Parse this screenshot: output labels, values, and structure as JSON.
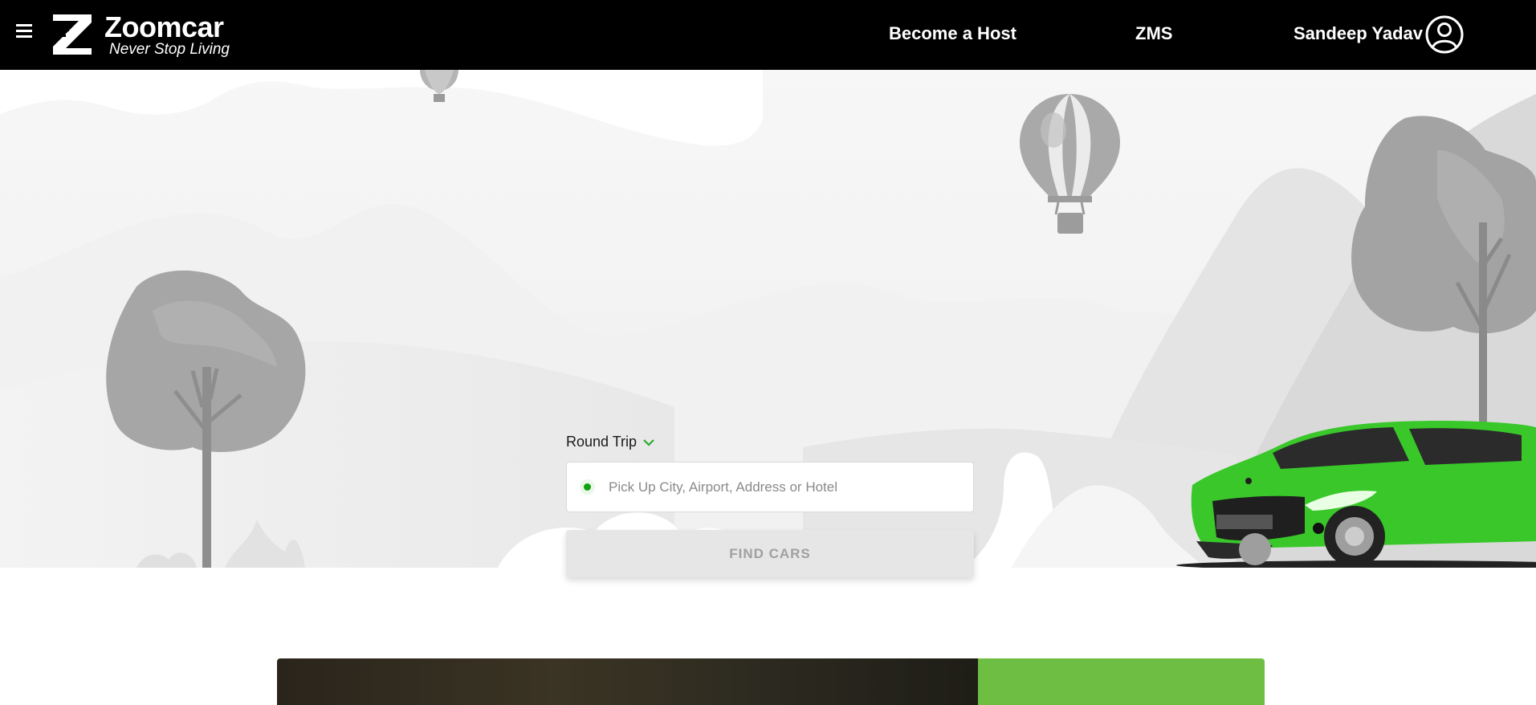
{
  "header": {
    "logo_name": "Zoomcar",
    "logo_tagline": "Never Stop Living",
    "nav": {
      "become_host": "Become a Host",
      "zms": "ZMS",
      "user_name": "Sandeep Yadav"
    },
    "icons": [
      "hamburger-menu-icon",
      "zoomcar-logo-icon",
      "user-avatar-icon"
    ]
  },
  "search": {
    "trip_type": "Round Trip",
    "pickup_placeholder": "Pick Up City, Airport, Address or Hotel",
    "pickup_value": "",
    "find_button": "FIND CARS"
  },
  "colors": {
    "header_bg": "#000000",
    "accent_green": "#3cbe28",
    "button_disabled_bg": "#e6e6e6",
    "banner_green": "#6fbe44"
  }
}
